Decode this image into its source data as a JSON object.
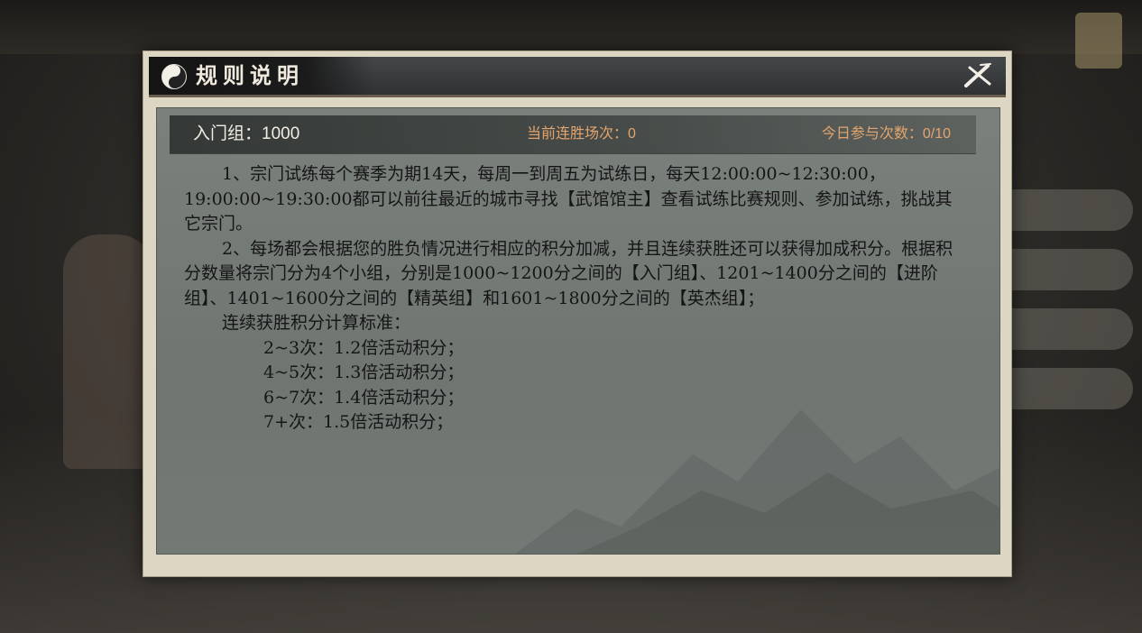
{
  "dialog": {
    "title": "规则说明",
    "close_icon": "close-x-icon",
    "title_icon": "yin-yang-icon"
  },
  "stats": {
    "group": "入门组：1000",
    "streak": "当前连胜场次：0",
    "participation": "今日参与次数：0/10"
  },
  "rules": {
    "p1": "1、宗门试练每个赛季为期14天，每周一到周五为试练日，每天12:00:00~12:30:00，19:00:00~19:30:00都可以前往最近的城市寻找【武馆馆主】查看试练比赛规则、参加试练，挑战其它宗门。",
    "p2": "2、每场都会根据您的胜负情况进行相应的积分加减，并且连续获胜还可以获得加成积分。根据积分数量将宗门分为4个小组，分别是1000~1200分之间的【入门组】、1201~1400分之间的【进阶组】、1401~1600分之间的【精英组】和1601~1800分之间的【英杰组】；",
    "bonus_title": "连续获胜积分计算标准：",
    "bonus_items": [
      "2~3次：1.2倍活动积分；",
      "4~5次：1.3倍活动积分；",
      "6~7次：1.4倍活动积分；",
      "7+次：1.5倍活动积分；"
    ]
  },
  "colors": {
    "title_bar": "#2f3133",
    "panel": "#737975",
    "frame": "#ddd6c2",
    "accent_orange": "#e3a56e"
  }
}
